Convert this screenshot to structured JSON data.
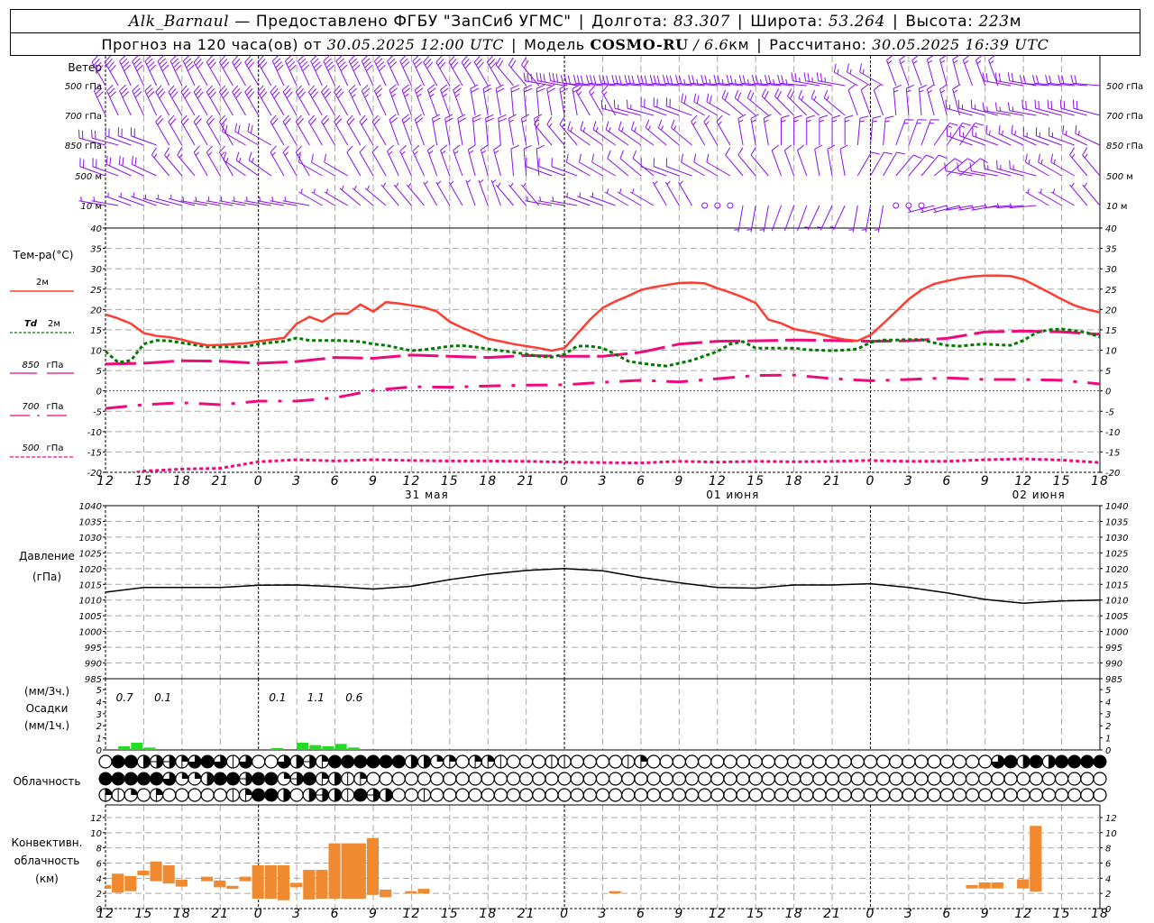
{
  "header": {
    "station": "Alk_Barnaul",
    "dash": "—",
    "provider": "Предоставлено ФГБУ \"ЗапСиб УГМС\"",
    "separator": "|",
    "lon_label": "Долгота:",
    "lon": "83.307",
    "lat_label": "Широта:",
    "lat": "53.264",
    "alt_label": "Высота:",
    "alt": "223",
    "alt_unit": "м",
    "forecast_label": "Прогноз на 120 часа(ов) от",
    "run_time": "30.05.2025 12:00 UTC",
    "model_label": "Модель",
    "model": "COSMO-RU",
    "slash": "/",
    "resolution": "6.6",
    "res_unit": "км",
    "computed_label": "Рассчитано:",
    "computed_time": "30.05.2025 16:39 UTC"
  },
  "colors": {
    "wind": "#8a10f0",
    "t2m": "#ff3c32",
    "td2m": "#007a00",
    "levels": "#f0087c",
    "zero_line": "#2040ff",
    "pressure": "#000000",
    "precip": "#22dd22",
    "convective": "#f08a30",
    "grid": "#a8a8a8"
  },
  "time_axis": {
    "tick_labels": [
      "12",
      "15",
      "18",
      "21",
      "0",
      "3",
      "6",
      "9",
      "12",
      "15",
      "18",
      "21",
      "0",
      "3",
      "6",
      "9",
      "12",
      "15",
      "18",
      "21",
      "0",
      "3",
      "6",
      "9",
      "12",
      "15",
      "18"
    ],
    "dates": [
      {
        "label": "31 мая",
        "hour": 24
      },
      {
        "label": "01 июня",
        "hour": 48
      },
      {
        "label": "02 июня",
        "hour": 72
      }
    ]
  },
  "wind": {
    "title": "Ветер",
    "levels": [
      {
        "label_num": "500",
        "label_unit": "гПа",
        "dir": [
          330,
          335,
          335,
          330,
          330,
          335,
          335,
          335,
          335,
          330,
          330,
          320,
          280,
          275,
          275,
          275,
          275,
          275,
          275,
          280,
          300,
          340,
          345,
          340,
          280,
          275,
          275
        ],
        "speed": [
          20,
          20,
          20,
          15,
          15,
          20,
          20,
          20,
          15,
          15,
          15,
          10,
          15,
          15,
          15,
          15,
          12,
          12,
          12,
          12,
          8,
          8,
          8,
          8,
          10,
          10,
          10
        ]
      },
      {
        "label_num": "700",
        "label_unit": "гПа",
        "dir": [
          335,
          335,
          330,
          330,
          330,
          330,
          330,
          335,
          340,
          340,
          350,
          355,
          350,
          330,
          285,
          290,
          300,
          310,
          315,
          310,
          340,
          355,
          345,
          285,
          280,
          285,
          285
        ],
        "speed": [
          15,
          15,
          15,
          15,
          15,
          15,
          15,
          12,
          12,
          12,
          10,
          10,
          10,
          8,
          8,
          10,
          10,
          10,
          10,
          8,
          5,
          8,
          8,
          8,
          8,
          10,
          10
        ]
      },
      {
        "label_num": "850",
        "label_unit": "гПа",
        "dir": [
          285,
          290,
          330,
          330,
          300,
          330,
          330,
          330,
          340,
          350,
          355,
          350,
          320,
          305,
          305,
          310,
          330,
          350,
          0,
          0,
          5,
          20,
          35,
          290,
          295,
          290,
          295
        ],
        "speed": [
          10,
          10,
          10,
          10,
          10,
          10,
          10,
          10,
          10,
          10,
          10,
          8,
          8,
          8,
          8,
          8,
          8,
          8,
          8,
          8,
          8,
          8,
          8,
          8,
          8,
          8,
          8
        ]
      },
      {
        "label_num": "500",
        "label_unit": "м",
        "dir": [
          290,
          295,
          320,
          330,
          305,
          330,
          300,
          330,
          335,
          340,
          345,
          355,
          290,
          300,
          310,
          290,
          300,
          320,
          340,
          350,
          30,
          40,
          50,
          280,
          285,
          300,
          320
        ],
        "speed": [
          10,
          10,
          8,
          8,
          8,
          8,
          5,
          5,
          8,
          8,
          8,
          5,
          5,
          5,
          5,
          5,
          5,
          5,
          5,
          5,
          5,
          5,
          5,
          5,
          8,
          8,
          8
        ]
      },
      {
        "label_num": "10",
        "label_unit": "м",
        "dir": [
          280,
          290,
          285,
          280,
          280,
          280,
          300,
          310,
          320,
          330,
          340,
          320,
          280,
          290,
          300,
          330,
          0,
          190,
          200,
          205,
          190,
          0,
          255,
          260,
          265,
          300,
          320
        ],
        "speed": [
          3,
          3,
          3,
          2,
          3,
          3,
          3,
          3,
          3,
          3,
          3,
          3,
          3,
          3,
          3,
          2,
          0,
          3,
          3,
          3,
          2,
          0,
          3,
          3,
          3,
          3,
          3
        ]
      }
    ]
  },
  "temperature": {
    "title": "Тем-ра(°С)",
    "ylim": [
      -20,
      40
    ],
    "ticks": [
      40,
      35,
      30,
      25,
      20,
      15,
      10,
      5,
      0,
      -5,
      -10,
      -15,
      -20
    ],
    "t2m": {
      "legend": "2м",
      "values": [
        18.8,
        17.8,
        16.5,
        14.2,
        13.5,
        13.2,
        12.6,
        11.8,
        11.2,
        11.3,
        11.5,
        11.7,
        12.2,
        12.6,
        13,
        16.5,
        18.2,
        17,
        19,
        19,
        21.2,
        19.5,
        21.8,
        21.5,
        21,
        20.5,
        19.5,
        17,
        15.5,
        14.2,
        12.8,
        12.2,
        11.5,
        11,
        10.5,
        9.9,
        10.5,
        14,
        17.5,
        20.4,
        22,
        23.3,
        24.8,
        25.5,
        26,
        26.5,
        26.6,
        26.4,
        25.2,
        24.2,
        23,
        21.6,
        17.5,
        16.6,
        15.2,
        14.6,
        14,
        13.2,
        12.6,
        12.3,
        13.7,
        16.5,
        19.5,
        22.5,
        24.8,
        26.3,
        27,
        27.7,
        28.1,
        28.3,
        28.3,
        28.2,
        27.4,
        25.8,
        24.2,
        22.5,
        21,
        20,
        19.3
      ]
    },
    "td2m": {
      "legend_sym": "Td",
      "legend": "2м",
      "values": [
        9.7,
        7,
        7.5,
        11.5,
        12.4,
        12.3,
        11.8,
        11.3,
        10.8,
        10.8,
        10.8,
        10.9,
        11.5,
        11.9,
        12.2,
        13,
        12.4,
        12.4,
        12.4,
        12.3,
        12.1,
        11.5,
        11.2,
        10.5,
        9.9,
        10.1,
        10.5,
        11,
        11.1,
        10.8,
        10.3,
        9.9,
        9.5,
        9,
        8.5,
        8.3,
        9,
        11,
        11,
        10.5,
        9,
        7.3,
        6.8,
        6.4,
        6.1,
        6.8,
        7.5,
        8.6,
        9.7,
        11.5,
        12.1,
        10.5,
        10.5,
        10.5,
        10.5,
        10.1,
        10,
        9.9,
        10,
        10.3,
        11.9,
        12.5,
        12.5,
        12.6,
        12.6,
        11.8,
        11.2,
        11,
        11.3,
        11.5,
        11.3,
        11.2,
        12.4,
        14.3,
        15,
        15.2,
        14.8,
        14.3,
        13.2
      ]
    },
    "t850": {
      "legend_num": "850",
      "legend_unit": "гПа",
      "values": [
        6.6,
        6.8,
        7.4,
        7.3,
        6.8,
        7.2,
        8.2,
        8,
        8.8,
        8.5,
        8.2,
        8.7,
        8.5,
        8.5,
        9.5,
        11.5,
        12.2,
        12.3,
        12.5,
        12.4,
        12.2,
        12.3,
        12.9,
        14.5,
        14.7,
        14.5,
        13.9
      ]
    },
    "t700": {
      "legend_num": "700",
      "legend_unit": "гПа",
      "values": [
        -4.3,
        -3.4,
        -2.9,
        -3.4,
        -2.5,
        -2.5,
        -1.7,
        0.1,
        1,
        0.9,
        1.2,
        1.4,
        1.5,
        2.1,
        2.6,
        2.2,
        3,
        3.8,
        3.9,
        3,
        2.5,
        2.8,
        3.2,
        2.8,
        2.8,
        2.6,
        1.7
      ]
    },
    "t500": {
      "legend_num": "500",
      "legend_unit": "гПа",
      "values": [
        -21.5,
        -19.7,
        -19.2,
        -19,
        -17.4,
        -16.9,
        -17.2,
        -16.9,
        -17.1,
        -17.2,
        -17.2,
        -17.3,
        -17.5,
        -17.6,
        -17.7,
        -17.3,
        -17.5,
        -17.3,
        -17.4,
        -17.3,
        -17.1,
        -17.3,
        -17.3,
        -16.9,
        -16.7,
        -17,
        -17.6
      ]
    }
  },
  "pressure": {
    "title": "Давление",
    "unit": "(гПа)",
    "ylim": [
      985,
      1040
    ],
    "ticks": [
      1040,
      1035,
      1030,
      1025,
      1020,
      1015,
      1010,
      1005,
      1000,
      995,
      990,
      985
    ],
    "values": [
      1012.5,
      1014,
      1014,
      1014,
      1014.7,
      1014.8,
      1014.3,
      1013.5,
      1014.4,
      1016.5,
      1018.2,
      1019.4,
      1020,
      1019.3,
      1017.2,
      1015.5,
      1014,
      1013.8,
      1014.8,
      1014.8,
      1015.2,
      1014,
      1012.3,
      1010.2,
      1009,
      1009.7,
      1010
    ]
  },
  "precip": {
    "unit3": "(мм/3ч.)",
    "title": "Осадки",
    "unit1": "(мм/1ч.)",
    "ticks": [
      5,
      4,
      3,
      2,
      1,
      0
    ],
    "totals_3h": [
      {
        "hour": 1.5,
        "text": "0.7"
      },
      {
        "hour": 4.5,
        "text": "0.1"
      },
      {
        "hour": 13.5,
        "text": "0.1"
      },
      {
        "hour": 16.5,
        "text": "1.1"
      },
      {
        "hour": 19.5,
        "text": "0.6"
      }
    ],
    "hourly": [
      {
        "hour": 1,
        "mm": 0.3
      },
      {
        "hour": 2,
        "mm": 0.6
      },
      {
        "hour": 3,
        "mm": 0.2
      },
      {
        "hour": 13,
        "mm": 0.15
      },
      {
        "hour": 15,
        "mm": 0.6
      },
      {
        "hour": 16,
        "mm": 0.4
      },
      {
        "hour": 17,
        "mm": 0.3
      },
      {
        "hour": 18,
        "mm": 0.5
      },
      {
        "hour": 19,
        "mm": 0.2
      }
    ]
  },
  "cloudiness": {
    "title": "Облачность",
    "rows_oktas": [
      "088455368616006453888888442303310001100001300000000000000000000000000068484888888",
      "8888862248858825834130000000000000000000000000000000000000000000000000000000000",
      "3120300000138840454185400100000000000000000000000000000000000000000000000000000"
    ]
  },
  "convective": {
    "title1": "Конвективн.",
    "title2": "облачность",
    "unit": "(км)",
    "ticks": [
      12,
      10,
      8,
      6,
      4,
      2,
      0
    ],
    "bars": [
      {
        "h0": 0,
        "h1": 0.5,
        "base": 2.6,
        "top": 3.1
      },
      {
        "h0": 0.5,
        "h1": 1.5,
        "base": 2.1,
        "top": 4.6
      },
      {
        "h0": 1.5,
        "h1": 2.5,
        "base": 2.3,
        "top": 4.3
      },
      {
        "h0": 2.5,
        "h1": 3.5,
        "base": 4.4,
        "top": 5.0
      },
      {
        "h0": 3.5,
        "h1": 4.5,
        "base": 3.6,
        "top": 6.2
      },
      {
        "h0": 4.5,
        "h1": 5.5,
        "base": 3.3,
        "top": 5.7
      },
      {
        "h0": 5.5,
        "h1": 6.5,
        "base": 2.9,
        "top": 3.8
      },
      {
        "h0": 7.5,
        "h1": 8.5,
        "base": 3.6,
        "top": 4.2
      },
      {
        "h0": 8.5,
        "h1": 9.5,
        "base": 2.8,
        "top": 3.7
      },
      {
        "h0": 9.5,
        "h1": 10.5,
        "base": 2.6,
        "top": 3.0
      },
      {
        "h0": 10.5,
        "h1": 11.5,
        "base": 3.6,
        "top": 4.2
      },
      {
        "h0": 11.5,
        "h1": 12.5,
        "base": 1.3,
        "top": 5.7
      },
      {
        "h0": 12.5,
        "h1": 13.5,
        "base": 1.3,
        "top": 5.7
      },
      {
        "h0": 13.5,
        "h1": 14.5,
        "base": 1.1,
        "top": 5.7
      },
      {
        "h0": 14.5,
        "h1": 15.5,
        "base": 2.8,
        "top": 3.4
      },
      {
        "h0": 15.5,
        "h1": 16.5,
        "base": 1.2,
        "top": 5.1
      },
      {
        "h0": 16.5,
        "h1": 17.5,
        "base": 1.3,
        "top": 5.1
      },
      {
        "h0": 17.5,
        "h1": 18.5,
        "base": 1.3,
        "top": 8.6
      },
      {
        "h0": 18.5,
        "h1": 20.5,
        "base": 1.3,
        "top": 8.6
      },
      {
        "h0": 20.5,
        "h1": 21.5,
        "base": 1.8,
        "top": 9.3
      },
      {
        "h0": 21.5,
        "h1": 22.5,
        "base": 1.5,
        "top": 2.5
      },
      {
        "h0": 23.5,
        "h1": 24.5,
        "base": 2.0,
        "top": 2.3
      },
      {
        "h0": 24.5,
        "h1": 25.5,
        "base": 2.0,
        "top": 2.6
      },
      {
        "h0": 39.5,
        "h1": 40.5,
        "base": 2.0,
        "top": 2.3
      },
      {
        "h0": 67.5,
        "h1": 68.5,
        "base": 2.65,
        "top": 3.1
      },
      {
        "h0": 68.5,
        "h1": 69.5,
        "base": 2.65,
        "top": 3.45
      },
      {
        "h0": 69.5,
        "h1": 70.5,
        "base": 2.65,
        "top": 3.45
      },
      {
        "h0": 71.5,
        "h1": 72.5,
        "base": 2.65,
        "top": 3.85
      },
      {
        "h0": 72.5,
        "h1": 73.5,
        "base": 2.25,
        "top": 10.9
      }
    ]
  }
}
